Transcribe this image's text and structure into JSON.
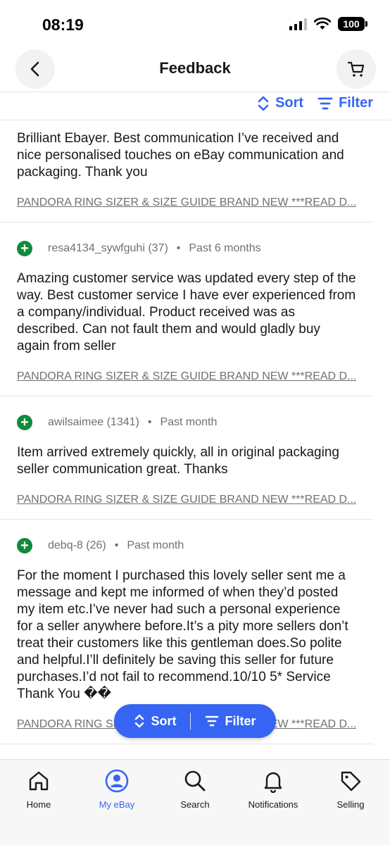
{
  "status_bar": {
    "time": "08:19",
    "battery": "100"
  },
  "header": {
    "title": "Feedback"
  },
  "toolbar": {
    "sort_label": "Sort",
    "filter_label": "Filter"
  },
  "feedback": [
    {
      "user": "",
      "period": "",
      "text": "Brilliant Ebayer. Best communication I’ve received and nice personalised touches on eBay communication and packaging. Thank you",
      "item": "PANDORA RING SIZER & SIZE GUIDE BRAND NEW ***READ D..."
    },
    {
      "user": "resa4134_sywfguhi (37)",
      "period": "Past 6 months",
      "text": "Amazing customer service was updated every step of the way. Best customer service I have ever experienced from a company/individual. Product received was as described. Can not fault them and would gladly buy again from seller",
      "item": "PANDORA RING SIZER & SIZE GUIDE BRAND NEW ***READ D..."
    },
    {
      "user": "awilsaimee (1341)",
      "period": "Past month",
      "text": "Item arrived extremely quickly, all in original packaging seller communication great. Thanks",
      "item": "PANDORA RING SIZER & SIZE GUIDE BRAND NEW ***READ D..."
    },
    {
      "user": "debq-8 (26)",
      "period": "Past month",
      "text": "For the moment I purchased this lovely seller sent me a message and kept me informed of when they’d posted my item etc.I’ve never had such a personal experience for a seller anywhere before.It’s a pity more sellers don’t treat their customers like this gentleman does.So polite and helpful.I’ll definitely be saving this seller for future purchases.I’d not fail to recommend.10/10 5* Service Thank You ��",
      "item": "PANDORA RING SIZER & SIZE GUIDE BRAND NEW ***READ D..."
    }
  ],
  "floating_bar": {
    "sort_label": "Sort",
    "filter_label": "Filter"
  },
  "bottom_nav": [
    {
      "label": "Home",
      "icon": "home-icon"
    },
    {
      "label": "My eBay",
      "icon": "user-icon",
      "active": true
    },
    {
      "label": "Search",
      "icon": "search-icon"
    },
    {
      "label": "Notifications",
      "icon": "bell-icon"
    },
    {
      "label": "Selling",
      "icon": "tag-icon"
    }
  ],
  "colors": {
    "accent": "#3665f3",
    "positive": "#118a3a"
  }
}
